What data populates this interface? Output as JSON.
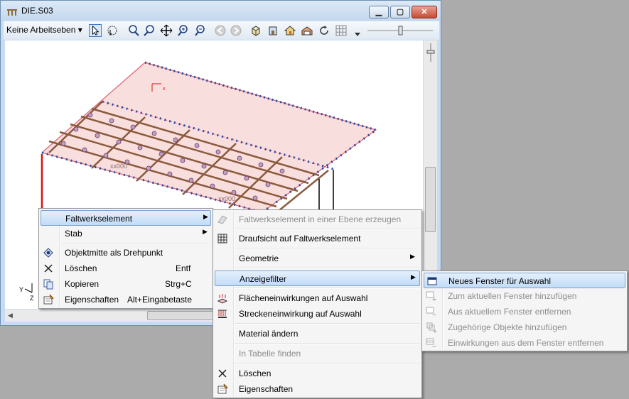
{
  "window": {
    "title": "DIE.S03",
    "minimize_glyph": "▁",
    "maximize_glyph": "▢",
    "close_glyph": "✕"
  },
  "toolbar": {
    "layer_combo": "Keine Arbeitseben ▾",
    "icons": [
      "pointer-icon",
      "rotate-view-icon",
      "zoom-window-icon",
      "zoom-icon",
      "pan-icon",
      "zoom-in-icon",
      "zoom-out-icon",
      "undo-view-icon",
      "redo-view-icon",
      "cube-view-icon",
      "front-view-icon",
      "home-view-icon",
      "side-view-icon",
      "refresh-icon",
      "grid-icon"
    ]
  },
  "canvas": {
    "axis_y": "Y",
    "axis_z": "Z",
    "axis_x": "x",
    "label_1": "xx000",
    "label_2": "xx000"
  },
  "context_menu": {
    "items": [
      {
        "label": "Faltwerkselement",
        "submenu": true,
        "highlighted": true
      },
      {
        "label": "Stab",
        "submenu": true
      },
      {
        "label": "Objektmitte als Drehpunkt",
        "icon": "target-icon"
      },
      {
        "label": "Löschen",
        "shortcut": "Entf",
        "icon": "delete-x-icon"
      },
      {
        "label": "Kopieren",
        "shortcut": "Strg+C",
        "icon": "copy-icon"
      },
      {
        "label": "Eigenschaften",
        "shortcut": "Alt+Eingabetaste",
        "icon": "properties-icon"
      }
    ]
  },
  "submenu": {
    "items": [
      {
        "label": "Faltwerkselement in einer Ebene erzeugen",
        "disabled": true,
        "icon": "plane-element-icon"
      },
      {
        "label": "Draufsicht auf Faltwerkselement",
        "icon": "plan-view-icon"
      },
      {
        "label": "Geometrie",
        "submenu": true
      },
      {
        "label": "Anzeigefilter",
        "submenu": true,
        "highlighted": true
      },
      {
        "label": "Flächeneinwirkungen auf Auswahl",
        "icon": "area-load-icon"
      },
      {
        "label": "Streckeneinwirkung auf Auswahl",
        "icon": "line-load-icon"
      },
      {
        "label": "Material ändern"
      },
      {
        "label": "In Tabelle finden",
        "disabled": true
      },
      {
        "label": "Löschen",
        "icon": "delete-x-icon"
      },
      {
        "label": "Eigenschaften",
        "icon": "properties-icon"
      }
    ]
  },
  "subsubmenu": {
    "items": [
      {
        "label": "Neues Fenster für Auswahl",
        "highlighted": true,
        "icon": "new-window-icon"
      },
      {
        "label": "Zum aktuellen Fenster hinzufügen",
        "disabled": true,
        "icon": "add-to-window-icon"
      },
      {
        "label": "Aus aktuellem Fenster entfernen",
        "disabled": true,
        "icon": "remove-from-window-icon"
      },
      {
        "label": "Zugehörige Objekte hinzufügen",
        "disabled": true,
        "icon": "add-related-icon"
      },
      {
        "label": "Einwirkungen aus dem Fenster entfernen",
        "disabled": true,
        "icon": "remove-loads-icon"
      }
    ]
  },
  "colors": {
    "slab_fill": "#f9dede",
    "slab_edge": "#e06070",
    "beam": "#8b5a3c",
    "support": "#2848a0",
    "column": "#e01010",
    "highlight": "#c2dcf7"
  }
}
